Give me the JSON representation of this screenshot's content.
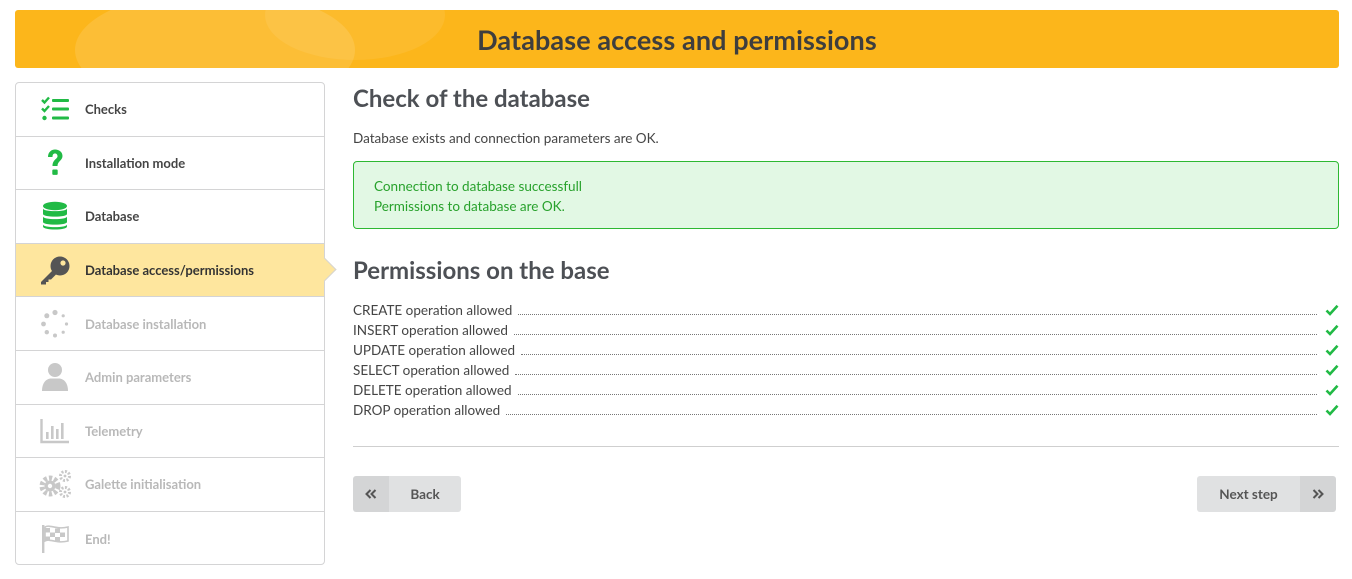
{
  "header": {
    "title": "Database access and permissions"
  },
  "sidebar": {
    "steps": [
      {
        "label": "Checks",
        "icon": "checklist-icon",
        "state": "done"
      },
      {
        "label": "Installation mode",
        "icon": "question-icon",
        "state": "done"
      },
      {
        "label": "Database",
        "icon": "database-icon",
        "state": "done"
      },
      {
        "label": "Database access/permissions",
        "icon": "key-icon",
        "state": "active"
      },
      {
        "label": "Database installation",
        "icon": "spinner-icon",
        "state": "disabled"
      },
      {
        "label": "Admin parameters",
        "icon": "user-icon",
        "state": "disabled"
      },
      {
        "label": "Telemetry",
        "icon": "chart-icon",
        "state": "disabled"
      },
      {
        "label": "Galette initialisation",
        "icon": "cogs-icon",
        "state": "disabled"
      },
      {
        "label": "End!",
        "icon": "flag-icon",
        "state": "disabled"
      }
    ]
  },
  "main": {
    "check_title": "Check of the database",
    "intro": "Database exists and connection parameters are OK.",
    "success": {
      "line1": "Connection to database successfull",
      "line2": "Permissions to database are OK."
    },
    "permissions_title": "Permissions on the base",
    "permissions": [
      {
        "label": "CREATE operation allowed",
        "ok": true
      },
      {
        "label": "INSERT operation allowed",
        "ok": true
      },
      {
        "label": "UPDATE operation allowed",
        "ok": true
      },
      {
        "label": "SELECT operation allowed",
        "ok": true
      },
      {
        "label": "DELETE operation allowed",
        "ok": true
      },
      {
        "label": "DROP operation allowed",
        "ok": true
      }
    ]
  },
  "buttons": {
    "back": "Back",
    "next": "Next step"
  },
  "colors": {
    "accent": "#fcb61b",
    "active_step": "#fee69e",
    "success": "#27a12b",
    "success_bg": "#e2f8e4",
    "icon_green": "#21ba45",
    "icon_disabled": "#c8c8c8"
  }
}
